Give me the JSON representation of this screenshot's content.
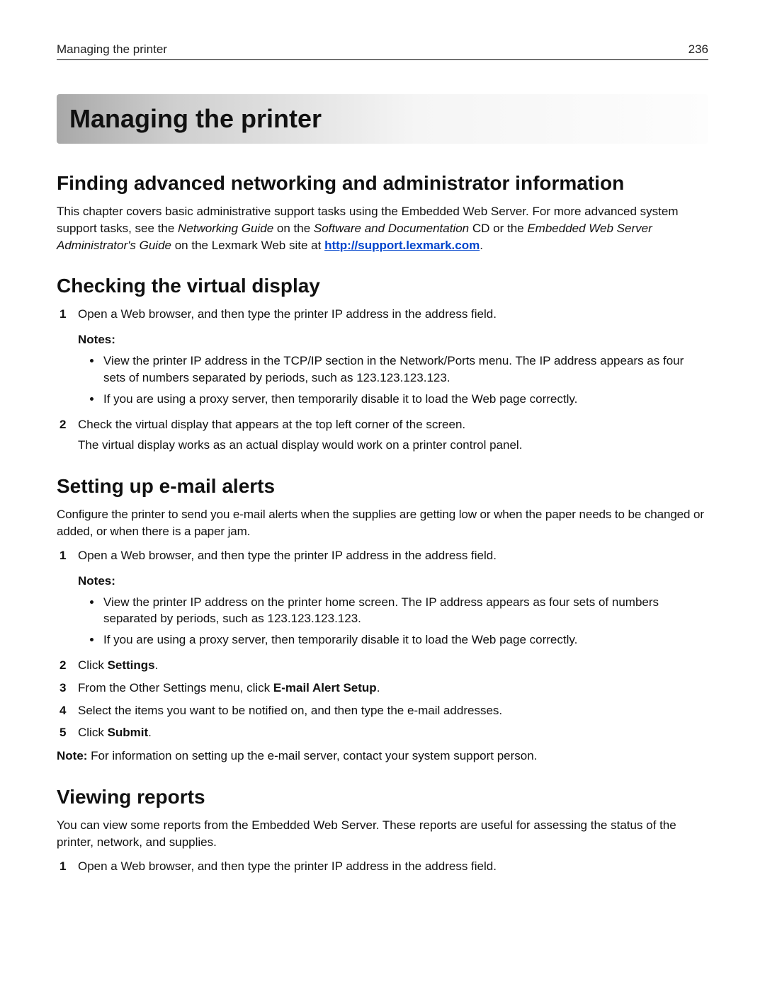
{
  "header": {
    "left": "Managing the printer",
    "right": "236"
  },
  "title": "Managing the printer",
  "section_finding": {
    "heading": "Finding advanced networking and administrator information",
    "intro_parts": {
      "p1": "This chapter covers basic administrative support tasks using the Embedded Web Server. For more advanced system support tasks, see the ",
      "italic1": "Networking Guide",
      "p2": " on the ",
      "italic2": "Software and Documentation",
      "p3": " CD or the ",
      "italic3": "Embedded Web Server Administrator's Guide",
      "p4": " on the Lexmark Web site at ",
      "link": "http://support.lexmark.com",
      "p5": "."
    }
  },
  "section_virtual": {
    "heading": "Checking the virtual display",
    "step1": "Open a Web browser, and then type the printer IP address in the address field.",
    "notes_label": "Notes:",
    "bullets": [
      "View the printer IP address in the TCP/IP section in the Network/Ports menu. The IP address appears as four sets of numbers separated by periods, such as 123.123.123.123.",
      "If you are using a proxy server, then temporarily disable it to load the Web page correctly."
    ],
    "step2": "Check the virtual display that appears at the top left corner of the screen.",
    "step2_sub": "The virtual display works as an actual display would work on a printer control panel."
  },
  "section_email": {
    "heading": "Setting up e‑mail alerts",
    "intro": "Configure the printer to send you e‑mail alerts when the supplies are getting low or when the paper needs to be changed or added, or when there is a paper jam.",
    "step1": "Open a Web browser, and then type the printer IP address in the address field.",
    "notes_label": "Notes:",
    "bullets": [
      "View the printer IP address on the printer home screen. The IP address appears as four sets of numbers separated by periods, such as 123.123.123.123.",
      "If you are using a proxy server, then temporarily disable it to load the Web page correctly."
    ],
    "step2_pre": "Click ",
    "step2_bold": "Settings",
    "step2_post": ".",
    "step3_pre": "From the Other Settings menu, click ",
    "step3_bold": "E‑mail Alert Setup",
    "step3_post": ".",
    "step4": "Select the items you want to be notified on, and then type the e‑mail addresses.",
    "step5_pre": "Click ",
    "step5_bold": "Submit",
    "step5_post": ".",
    "note_pre": "Note:",
    "note_body": " For information on setting up the e‑mail server, contact your system support person."
  },
  "section_reports": {
    "heading": "Viewing reports",
    "intro": "You can view some reports from the Embedded Web Server. These reports are useful for assessing the status of the printer, network, and supplies.",
    "step1": "Open a Web browser, and then type the printer IP address in the address field."
  },
  "nums": {
    "n1": "1",
    "n2": "2",
    "n3": "3",
    "n4": "4",
    "n5": "5"
  }
}
